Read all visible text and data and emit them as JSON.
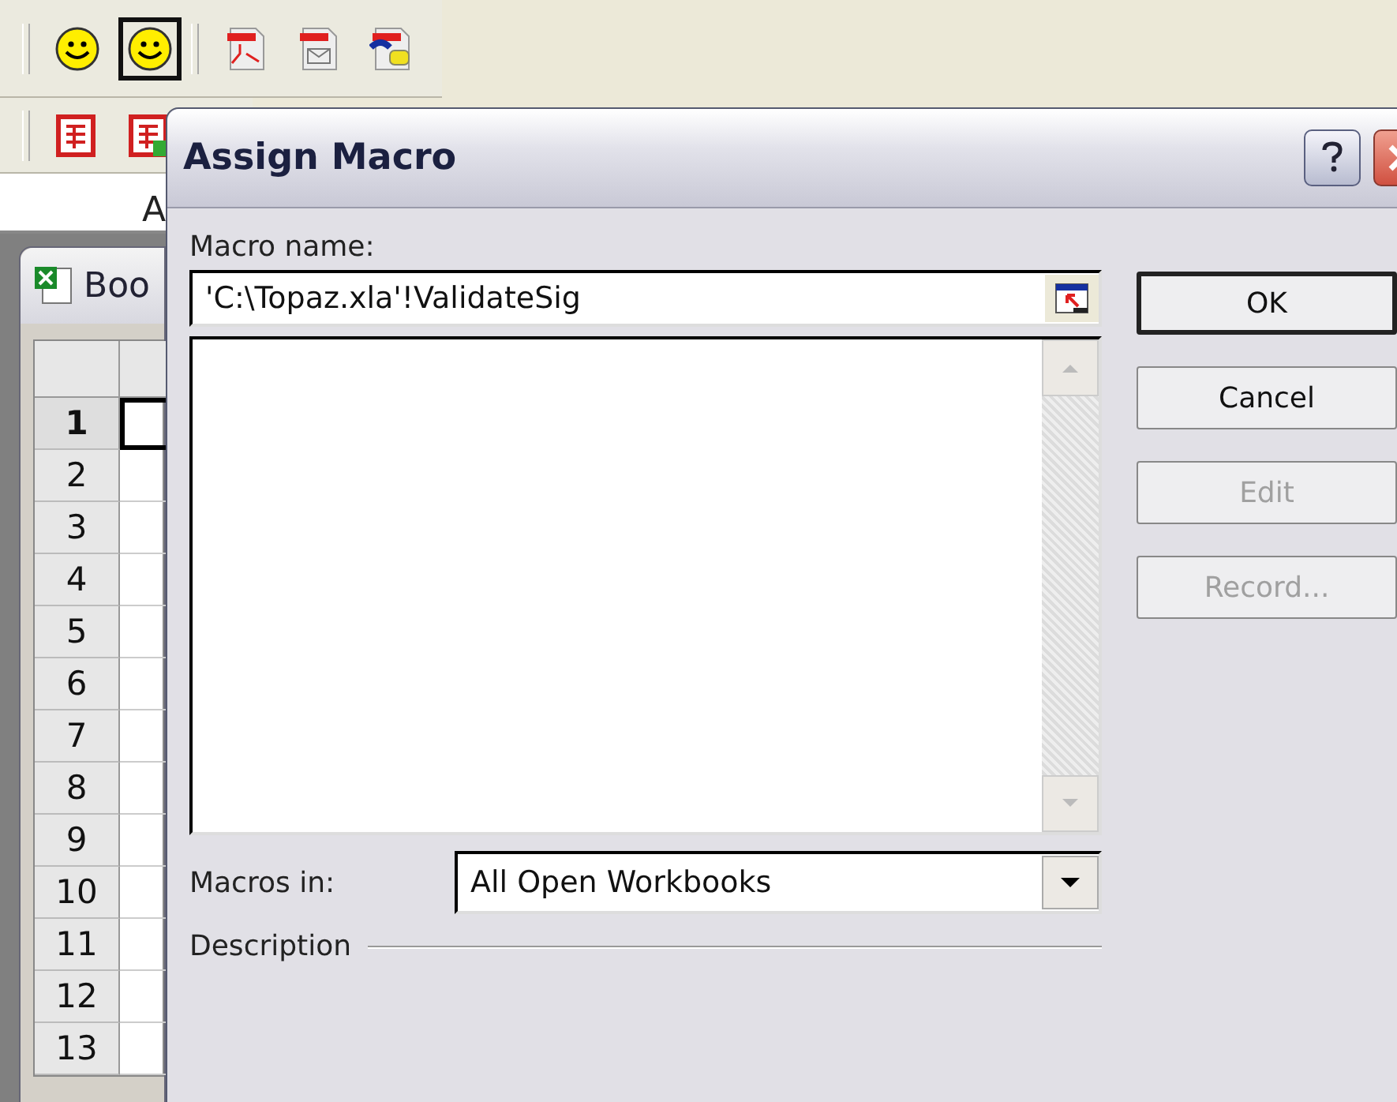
{
  "toolbar_top": {
    "buttons": [
      {
        "kind": "smiley",
        "selected": false
      },
      {
        "kind": "smiley",
        "selected": true
      },
      {
        "kind": "pdf",
        "selected": false
      },
      {
        "kind": "pdf-mail",
        "selected": false
      },
      {
        "kind": "pdf-comment",
        "selected": false
      }
    ]
  },
  "toolbar_second": {
    "buttons": [
      {
        "kind": "sheet",
        "selected": false
      },
      {
        "kind": "sheet-go",
        "selected": false
      }
    ]
  },
  "formula_bar": {
    "text": "A"
  },
  "workbook": {
    "title": "Boo",
    "rows": [
      {
        "label": "1",
        "selected": true
      },
      {
        "label": "2",
        "selected": false
      },
      {
        "label": "3",
        "selected": false
      },
      {
        "label": "4",
        "selected": false
      },
      {
        "label": "5",
        "selected": false
      },
      {
        "label": "6",
        "selected": false
      },
      {
        "label": "7",
        "selected": false
      },
      {
        "label": "8",
        "selected": false
      },
      {
        "label": "9",
        "selected": false
      },
      {
        "label": "10",
        "selected": false
      },
      {
        "label": "11",
        "selected": false
      },
      {
        "label": "12",
        "selected": false
      },
      {
        "label": "13",
        "selected": false
      }
    ]
  },
  "dialog": {
    "title": "Assign Macro",
    "macro_name_label": "Macro name:",
    "macro_name_value": "'C:\\Topaz.xla'!ValidateSig",
    "macros_in_label": "Macros in:",
    "macros_in_value": "All Open Workbooks",
    "description_label": "Description",
    "buttons": [
      {
        "label": "OK",
        "default": true,
        "disabled": false
      },
      {
        "label": "Cancel",
        "default": false,
        "disabled": false
      },
      {
        "label": "Edit",
        "default": false,
        "disabled": true
      },
      {
        "label": "Record...",
        "default": false,
        "disabled": true
      }
    ]
  }
}
